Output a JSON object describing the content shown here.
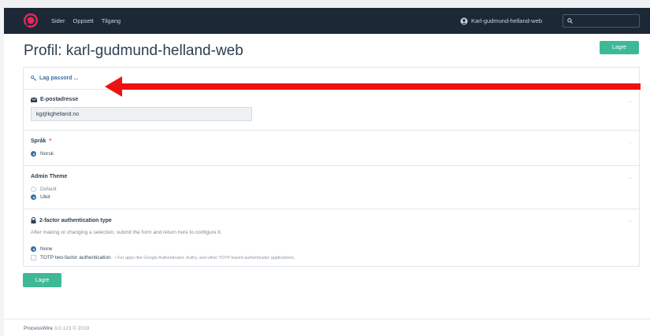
{
  "header": {
    "nav": [
      "Sider",
      "Oppsett",
      "Tilgang"
    ],
    "user": "Karl-gudmund-helland-web",
    "search_placeholder": ""
  },
  "page": {
    "title": "Profil: karl-gudmund-helland-web",
    "save_label": "Lagre"
  },
  "fields": {
    "password": {
      "link": "Lag passord ..."
    },
    "email": {
      "label": "E-postadresse",
      "value": "kg@kghelland.no"
    },
    "language": {
      "label": "Språk",
      "required_mark": "*",
      "options": [
        "Norsk"
      ]
    },
    "theme": {
      "label": "Admin Theme",
      "options": [
        "Default",
        "Uikit"
      ]
    },
    "tfa": {
      "label": "2-factor authentication type",
      "description": "After making or changing a selection, submit the form and return here to configure it.",
      "option_none": "None",
      "option_totp": "TOTP two-factor authentication",
      "option_totp_note": "• For apps like Google Authenticator, Authy, and other TOTP-based authenticator applications."
    }
  },
  "footer": {
    "brand": "ProcessWire",
    "version": "3.0.123 © 2019"
  },
  "colors": {
    "accent": "#3eb998",
    "masthead": "#1c2836",
    "arrow": "#ee1111",
    "link": "#3a6fa4"
  },
  "icons": [
    "processwire-logo-icon",
    "user-circle-icon",
    "search-icon",
    "key-icon",
    "envelope-icon",
    "lock-icon",
    "chevron-down-icon",
    "arrow-left-icon"
  ]
}
